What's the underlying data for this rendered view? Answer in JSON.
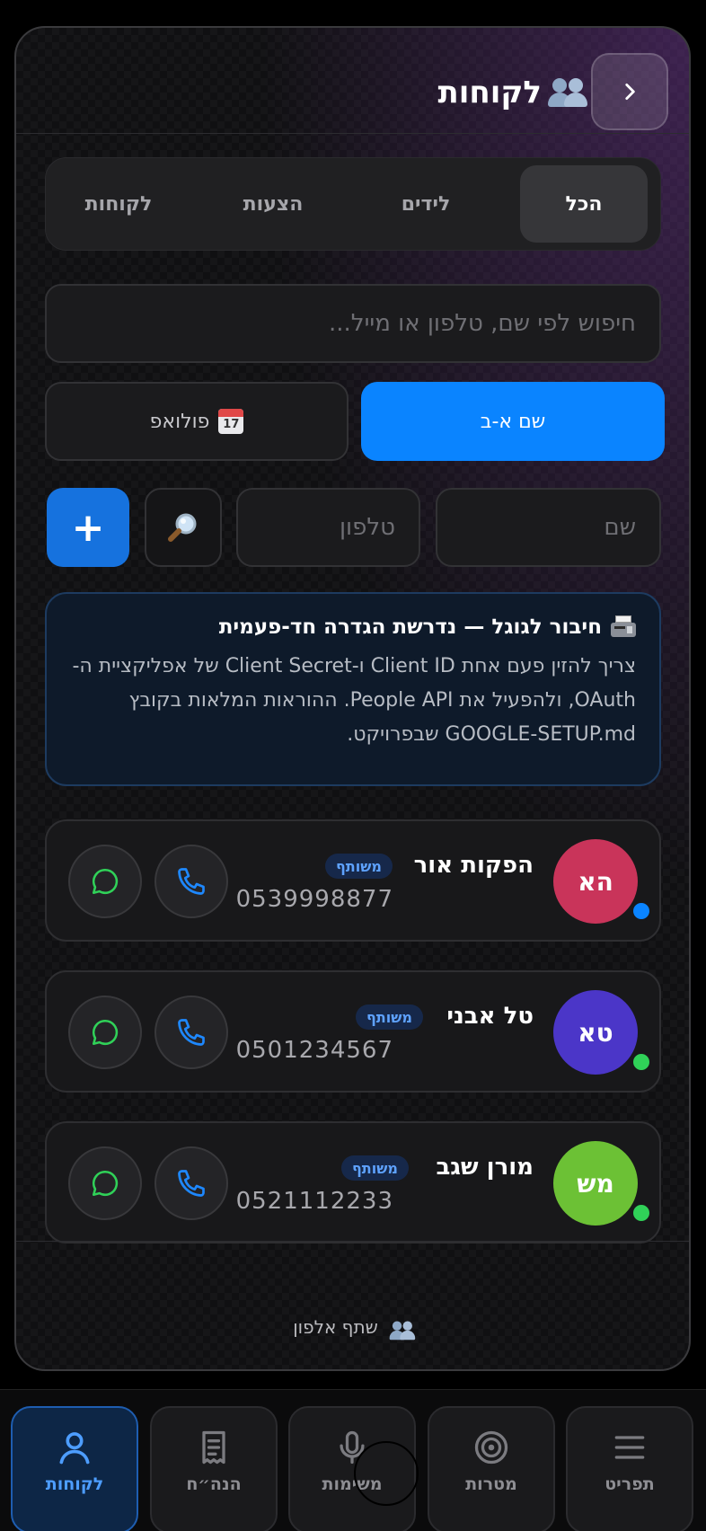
{
  "header": {
    "title": "לקוחות",
    "title_icon": "people-icon",
    "back_icon": "chevron-right-icon"
  },
  "tabs": [
    {
      "label": "הכל",
      "active": true
    },
    {
      "label": "לידים",
      "active": false
    },
    {
      "label": "הצעות",
      "active": false
    },
    {
      "label": "לקוחות",
      "active": false
    }
  ],
  "search": {
    "placeholder": "חיפוש לפי שם, טלפון או מייל..."
  },
  "sort": {
    "primary_label": "שם א-ב",
    "secondary_label": "פולואפ",
    "secondary_icon": "calendar-icon",
    "calendar_day": "17"
  },
  "quick_add": {
    "name_placeholder": "שם",
    "phone_placeholder": "טלפון",
    "lookup_icon": "magnifier-icon",
    "add_label": "+"
  },
  "google_notice": {
    "icon": "fax-icon",
    "title": "חיבור לגוגל — נדרשת הגדרה חד-פעמית",
    "body": "צריך להזין פעם אחת Client ID ו-Client Secret של אפליקציית ה-OAuth, ולהפעיל את People API. ההוראות המלאות בקובץ GOOGLE-SETUP.md שבפרויקט."
  },
  "contacts": [
    {
      "initials": "הא",
      "name": "הפקות אור",
      "badge": "משותף",
      "phone": "0539998877",
      "avatar_color": "#c9345a",
      "status_color": "#0a84ff"
    },
    {
      "initials": "טא",
      "name": "טל אבני",
      "badge": "משותף",
      "phone": "0501234567",
      "avatar_color": "#4b36c8",
      "status_color": "#30d158"
    },
    {
      "initials": "מש",
      "name": "מורן שגב",
      "badge": "משותף",
      "phone": "0521112233",
      "avatar_color": "#6cc135",
      "status_color": "#30d158"
    }
  ],
  "footer": {
    "text": "שתף אלפון",
    "icon": "people-icon"
  },
  "bottom_nav": [
    {
      "label": "לקוחות",
      "icon": "person-icon",
      "active": true
    },
    {
      "label": "הנה״ח",
      "icon": "receipt-icon",
      "active": false
    },
    {
      "label": "משימות",
      "icon": "microphone-icon",
      "active": false
    },
    {
      "label": "מטרות",
      "icon": "target-icon",
      "active": false
    },
    {
      "label": "תפריט",
      "icon": "menu-icon",
      "active": false
    }
  ],
  "colors": {
    "accent": "#0a84ff",
    "add_button": "#1672de",
    "whatsapp": "#30d158",
    "phone_icon": "#1e88ff"
  }
}
